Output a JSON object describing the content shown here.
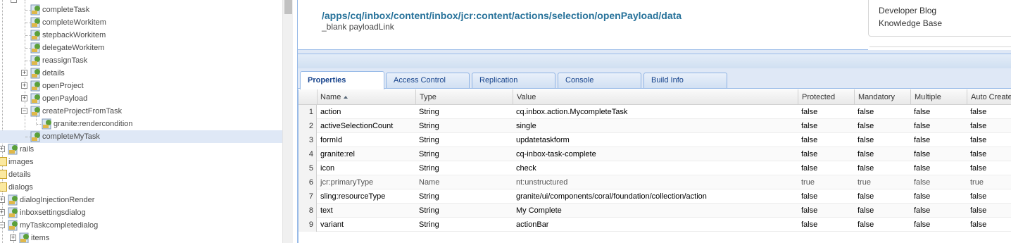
{
  "tree": {
    "items": [
      {
        "label": "completeTask"
      },
      {
        "label": "completeWorkitem"
      },
      {
        "label": "stepbackWorkitem"
      },
      {
        "label": "delegateWorkitem"
      },
      {
        "label": "reassignTask"
      },
      {
        "label": "details",
        "expander": "+"
      },
      {
        "label": "openProject",
        "expander": "+"
      },
      {
        "label": "openPayload",
        "expander": "+"
      },
      {
        "label": "createProjectFromTask",
        "expander": "−"
      },
      {
        "label": "granite:rendercondition"
      },
      {
        "label": "completeMyTask",
        "selected": true
      },
      {
        "label": "rails",
        "expander": "+"
      },
      {
        "label": "images"
      },
      {
        "label": "details"
      },
      {
        "label": "dialogs"
      },
      {
        "label": "dialogInjectionRender",
        "expander": "+"
      },
      {
        "label": "inboxsettingsdialog",
        "expander": "+"
      },
      {
        "label": "myTaskcompletedialog",
        "expander": "−"
      },
      {
        "label": "items",
        "expander": "+"
      }
    ]
  },
  "path_panel": {
    "path": "/apps/cq/inbox/content/inbox/jcr:content/actions/selection/openPayload/data",
    "subtitle": "_blank payloadLink"
  },
  "links": {
    "developer_blog": "Developer Blog",
    "knowledge_base": "Knowledge Base"
  },
  "tabs": [
    {
      "label": "Properties",
      "active": true
    },
    {
      "label": "Access Control"
    },
    {
      "label": "Replication"
    },
    {
      "label": "Console"
    },
    {
      "label": "Build Info"
    }
  ],
  "grid": {
    "columns": [
      "Name",
      "Type",
      "Value",
      "Protected",
      "Mandatory",
      "Multiple",
      "Auto Create"
    ],
    "rows": [
      {
        "num": "1",
        "name": "action",
        "type": "String",
        "value": "cq.inbox.action.MycompleteTask",
        "protected": "false",
        "mandatory": "false",
        "multiple": "false",
        "auto": "false"
      },
      {
        "num": "2",
        "name": "activeSelectionCount",
        "type": "String",
        "value": "single",
        "protected": "false",
        "mandatory": "false",
        "multiple": "false",
        "auto": "false"
      },
      {
        "num": "3",
        "name": "formId",
        "type": "String",
        "value": "updatetaskform",
        "protected": "false",
        "mandatory": "false",
        "multiple": "false",
        "auto": "false"
      },
      {
        "num": "4",
        "name": "granite:rel",
        "type": "String",
        "value": "cq-inbox-task-complete",
        "protected": "false",
        "mandatory": "false",
        "multiple": "false",
        "auto": "false"
      },
      {
        "num": "5",
        "name": "icon",
        "type": "String",
        "value": "check",
        "protected": "false",
        "mandatory": "false",
        "multiple": "false",
        "auto": "false"
      },
      {
        "num": "6",
        "name": "jcr:primaryType",
        "type": "Name",
        "value": "nt:unstructured",
        "protected": "true",
        "mandatory": "true",
        "multiple": "false",
        "auto": "true",
        "greyed": true
      },
      {
        "num": "7",
        "name": "sling:resourceType",
        "type": "String",
        "value": "granite/ui/components/coral/foundation/collection/action",
        "protected": "false",
        "mandatory": "false",
        "multiple": "false",
        "auto": "false"
      },
      {
        "num": "8",
        "name": "text",
        "type": "String",
        "value": "My Complete",
        "protected": "false",
        "mandatory": "false",
        "multiple": "false",
        "auto": "false"
      },
      {
        "num": "9",
        "name": "variant",
        "type": "String",
        "value": "actionBar",
        "protected": "false",
        "mandatory": "false",
        "multiple": "false",
        "auto": "false"
      }
    ]
  }
}
